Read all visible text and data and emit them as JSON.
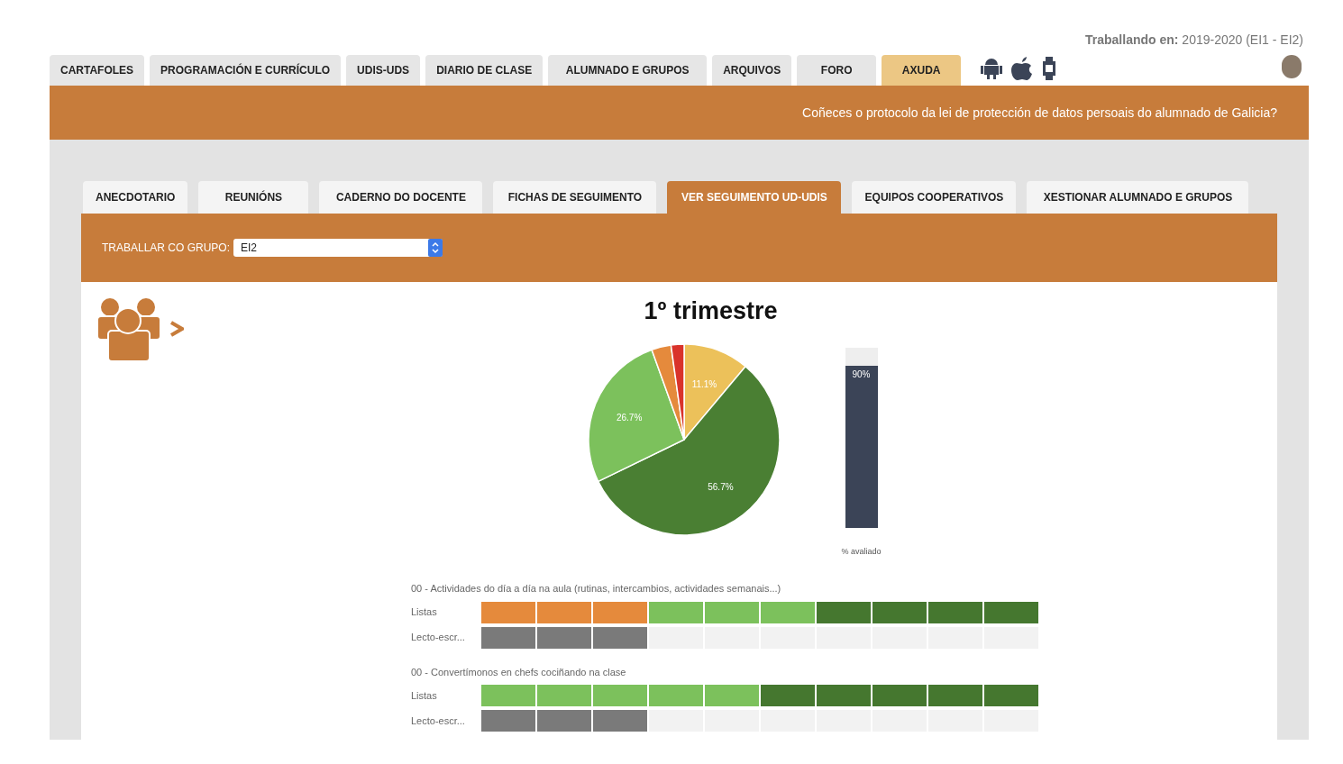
{
  "context": {
    "label": "Traballando en:",
    "value": "2019-2020 (EI1 - EI2)"
  },
  "main_tabs": [
    {
      "label": "CARTAFOLES",
      "selected": false
    },
    {
      "label": "PROGRAMACIÓN E CURRÍCULO",
      "selected": false
    },
    {
      "label": "UDIS-UDS",
      "selected": false
    },
    {
      "label": "DIARIO DE CLASE",
      "selected": false
    },
    {
      "label": "ALUMNADO E GRUPOS",
      "selected": false
    },
    {
      "label": "ARQUIVOS",
      "selected": false
    },
    {
      "label": "FORO",
      "selected": false
    },
    {
      "label": "AXUDA",
      "selected": true
    }
  ],
  "banner": "Coñeces o protocolo da lei de protección de datos persoais do alumnado de Galicia?",
  "sub_tabs": [
    {
      "label": "ANECDOTARIO",
      "selected": false
    },
    {
      "label": "REUNIÓNS",
      "selected": false
    },
    {
      "label": "CADERNO DO DOCENTE",
      "selected": false
    },
    {
      "label": "FICHAS DE SEGUIMENTO",
      "selected": false
    },
    {
      "label": "VER SEGUIMENTO UD-UDIS",
      "selected": true
    },
    {
      "label": "EQUIPOS COOPERATIVOS",
      "selected": false
    },
    {
      "label": "XESTIONAR ALUMNADO E GRUPOS",
      "selected": false
    }
  ],
  "group_select": {
    "label": "TRABALLAR CO GRUPO:",
    "value": "EI2"
  },
  "title": "1º trimestre",
  "pie": {
    "chart_data": {
      "type": "pie",
      "values": [
        11.1,
        56.7,
        26.7,
        3.3,
        2.2
      ],
      "colors": [
        "#ecc15a",
        "#4a7f33",
        "#7cc15c",
        "#e58a3c",
        "#d9332b"
      ],
      "value_labels": [
        "11.1%",
        "56.7%",
        "26.7%",
        null,
        null
      ]
    }
  },
  "progress": {
    "level": 0.9,
    "reading": "90%",
    "caption": "% avaliado"
  },
  "activities": [
    {
      "title": "00 - Actividades do día a día na aula (rutinas, intercambios, actividades semanais...)",
      "rows": [
        {
          "label": "Listas",
          "cells": [
            {
              "color": "#e58a3c"
            },
            {
              "color": "#e58a3c"
            },
            {
              "color": "#e58a3c"
            },
            {
              "color": "#7cc15c"
            },
            {
              "color": "#7cc15c"
            },
            {
              "color": "#7cc15c"
            },
            {
              "color": "#45772f"
            },
            {
              "color": "#45772f"
            },
            {
              "color": "#45772f"
            },
            {
              "color": "#45772f"
            }
          ]
        },
        {
          "label": "Lecto-escr...",
          "cells": [
            {
              "color": "#7a7a7a"
            },
            {
              "color": "#7a7a7a"
            },
            {
              "color": "#7a7a7a"
            },
            {
              "color": "#f2f2f2"
            },
            {
              "color": "#f2f2f2"
            },
            {
              "color": "#f2f2f2"
            },
            {
              "color": "#f2f2f2"
            },
            {
              "color": "#f2f2f2"
            },
            {
              "color": "#f2f2f2"
            },
            {
              "color": "#f2f2f2"
            }
          ]
        }
      ]
    },
    {
      "title": "00 - Convertímonos en chefs cociñando na clase",
      "rows": [
        {
          "label": "Listas",
          "cells": [
            {
              "color": "#7cc15c"
            },
            {
              "color": "#7cc15c"
            },
            {
              "color": "#7cc15c"
            },
            {
              "color": "#7cc15c"
            },
            {
              "color": "#7cc15c"
            },
            {
              "color": "#45772f"
            },
            {
              "color": "#45772f"
            },
            {
              "color": "#45772f"
            },
            {
              "color": "#45772f"
            },
            {
              "color": "#45772f"
            }
          ]
        },
        {
          "label": "Lecto-escr...",
          "cells": [
            {
              "color": "#7a7a7a"
            },
            {
              "color": "#7a7a7a"
            },
            {
              "color": "#7a7a7a"
            },
            {
              "color": "#f2f2f2"
            },
            {
              "color": "#f2f2f2"
            },
            {
              "color": "#f2f2f2"
            },
            {
              "color": "#f2f2f2"
            },
            {
              "color": "#f2f2f2"
            },
            {
              "color": "#f2f2f2"
            },
            {
              "color": "#f2f2f2"
            }
          ]
        }
      ]
    }
  ]
}
